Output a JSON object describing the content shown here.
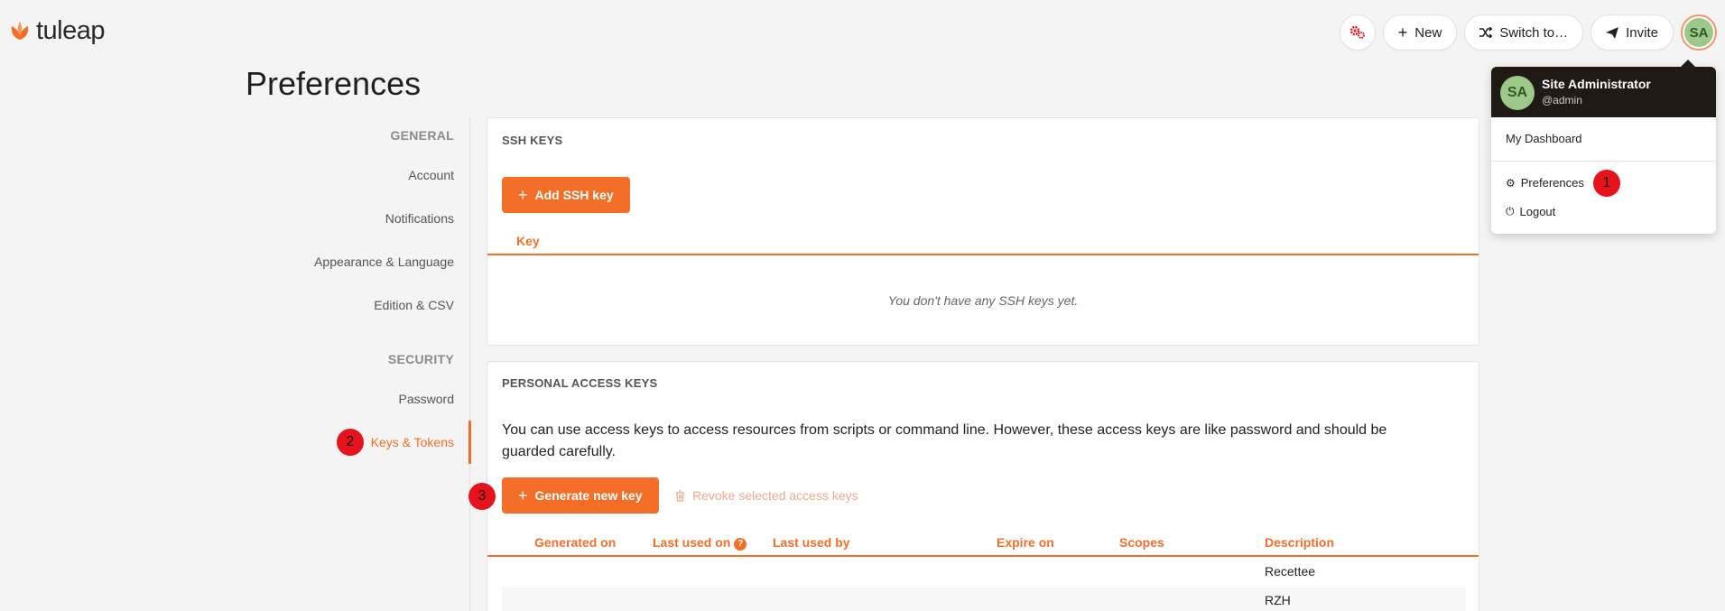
{
  "app": {
    "logo_text": "tuleap",
    "brand_color": "#f56e28"
  },
  "topbar": {
    "admin_icon": "gears-icon",
    "new_label": "New",
    "switch_label": "Switch to…",
    "invite_label": "Invite",
    "avatar_initials": "SA"
  },
  "page": {
    "title": "Preferences"
  },
  "sidebar": {
    "general_heading": "GENERAL",
    "account": "Account",
    "notifications": "Notifications",
    "appearance": "Appearance & Language",
    "edition": "Edition & CSV",
    "security_heading": "SECURITY",
    "password": "Password",
    "keys_tokens": "Keys & Tokens"
  },
  "ssh": {
    "title": "SSH KEYS",
    "add_button": "Add SSH key",
    "col_key": "Key",
    "empty": "You don't have any SSH keys yet."
  },
  "pak": {
    "title": "PERSONAL ACCESS KEYS",
    "intro": "You can use access keys to access resources from scripts or command line. However, these access keys are like password and should be guarded carefully.",
    "generate_button": "Generate new key",
    "revoke_button": "Revoke selected access keys",
    "columns": {
      "generated_on": "Generated on",
      "last_used_on": "Last used on",
      "last_used_by": "Last used by",
      "expire_on": "Expire on",
      "scopes": "Scopes",
      "description": "Description"
    },
    "rows": [
      {
        "description": "Recettee"
      },
      {
        "description": "RZH"
      }
    ]
  },
  "user_menu": {
    "name": "Site Administrator",
    "login": "@admin",
    "initials": "SA",
    "dashboard": "My Dashboard",
    "preferences": "Preferences",
    "logout": "Logout"
  },
  "markers": {
    "m1": "1",
    "m2": "2",
    "m3": "3"
  }
}
